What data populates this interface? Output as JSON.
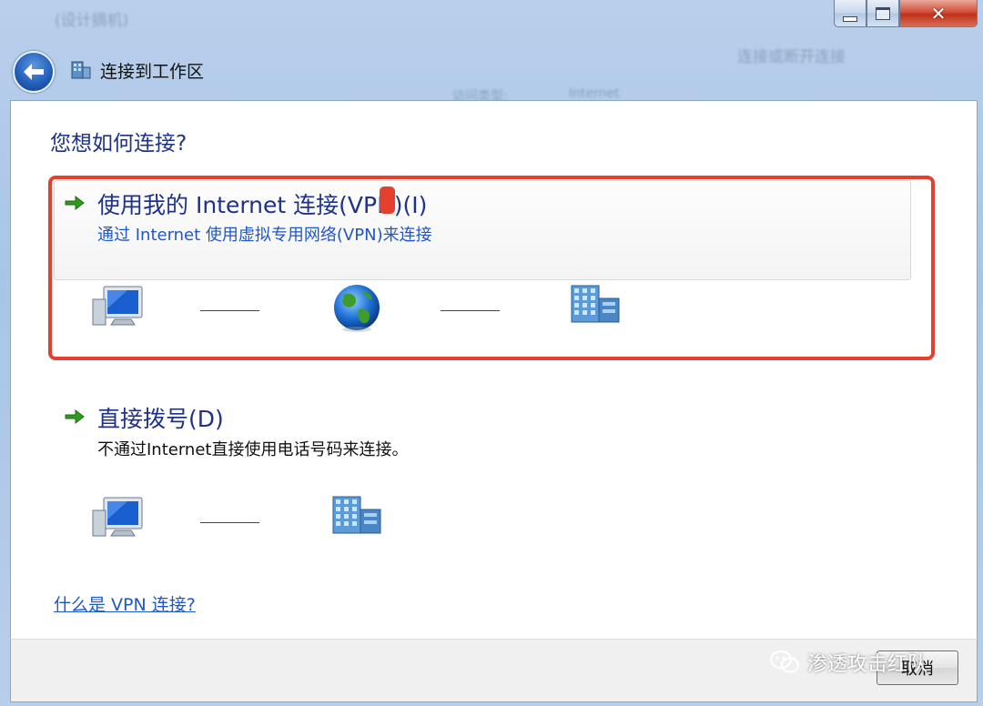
{
  "window": {
    "title": "连接到工作区",
    "caption": {
      "minimize": "—",
      "maximize": "□",
      "close": "✕"
    }
  },
  "question": "您想如何连接?",
  "options": [
    {
      "title": "使用我的 Internet 连接(VPN)(I)",
      "description": "通过 Internet 使用虚拟专用网络(VPN)来连接",
      "diagram": [
        "computer-icon",
        "globe-icon",
        "workplace-building-icon"
      ]
    },
    {
      "title": "直接拨号(D)",
      "description": "不通过Internet直接使用电话号码来连接。",
      "diagram": [
        "computer-icon",
        "workplace-building-icon"
      ]
    }
  ],
  "help_link": "什么是 VPN 连接?",
  "footer": {
    "cancel_label": "取消"
  },
  "watermark": "渗透攻击红队",
  "background_text": [
    "(设计摘机)",
    "连接或断开连接",
    "访问类型:",
    "Internet"
  ],
  "colors": {
    "title_blue": "#1e3287",
    "link_blue": "#1e57c8",
    "annotation_red": "#e5402e",
    "arrow_green": "#2f9a1e"
  }
}
